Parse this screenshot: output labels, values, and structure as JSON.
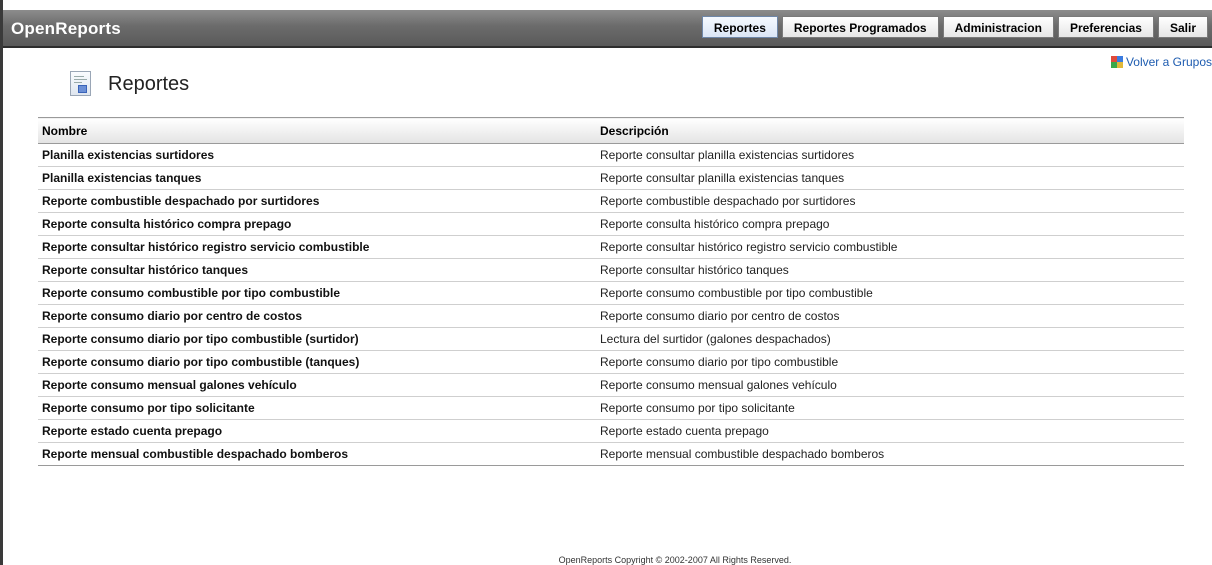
{
  "app": {
    "title": "OpenReports"
  },
  "nav": [
    {
      "label": "Reportes",
      "active": true
    },
    {
      "label": "Reportes Programados",
      "active": false
    },
    {
      "label": "Administracion",
      "active": false
    },
    {
      "label": "Preferencias",
      "active": false
    },
    {
      "label": "Salir",
      "active": false
    }
  ],
  "page": {
    "title": "Reportes",
    "back_link": "Volver a Grupos"
  },
  "table": {
    "headers": {
      "name": "Nombre",
      "description": "Descripción"
    },
    "rows": [
      {
        "name": "Planilla existencias surtidores",
        "description": "Reporte consultar planilla existencias surtidores"
      },
      {
        "name": "Planilla existencias tanques",
        "description": "Reporte consultar planilla existencias tanques"
      },
      {
        "name": "Reporte combustible despachado por surtidores",
        "description": "Reporte combustible despachado por surtidores"
      },
      {
        "name": "Reporte consulta histórico compra prepago",
        "description": "Reporte consulta histórico compra prepago"
      },
      {
        "name": "Reporte consultar histórico registro servicio combustible",
        "description": "Reporte consultar histórico registro servicio combustible"
      },
      {
        "name": "Reporte consultar histórico tanques",
        "description": "Reporte consultar histórico tanques"
      },
      {
        "name": "Reporte consumo combustible por tipo combustible",
        "description": "Reporte consumo combustible por tipo combustible"
      },
      {
        "name": "Reporte consumo diario por centro de costos",
        "description": "Reporte consumo diario por centro de costos"
      },
      {
        "name": "Reporte consumo diario por tipo combustible (surtidor)",
        "description": "Lectura del surtidor (galones despachados)"
      },
      {
        "name": "Reporte consumo diario por tipo combustible (tanques)",
        "description": "Reporte consumo diario por tipo combustible"
      },
      {
        "name": "Reporte consumo mensual galones vehículo",
        "description": "Reporte consumo mensual galones vehículo"
      },
      {
        "name": "Reporte consumo por tipo solicitante",
        "description": "Reporte consumo por tipo solicitante"
      },
      {
        "name": "Reporte estado cuenta prepago",
        "description": "Reporte estado cuenta prepago"
      },
      {
        "name": "Reporte mensual combustible despachado bomberos",
        "description": "Reporte mensual combustible despachado bomberos"
      }
    ]
  },
  "footer": {
    "text": "OpenReports Copyright © 2002-2007 All Rights Reserved."
  },
  "icons": {
    "page_icon": "report-document-icon",
    "back_icon": "groups-grid-icon"
  },
  "colors": {
    "topbar": "#6b6b6b",
    "link": "#1e5cb0"
  }
}
